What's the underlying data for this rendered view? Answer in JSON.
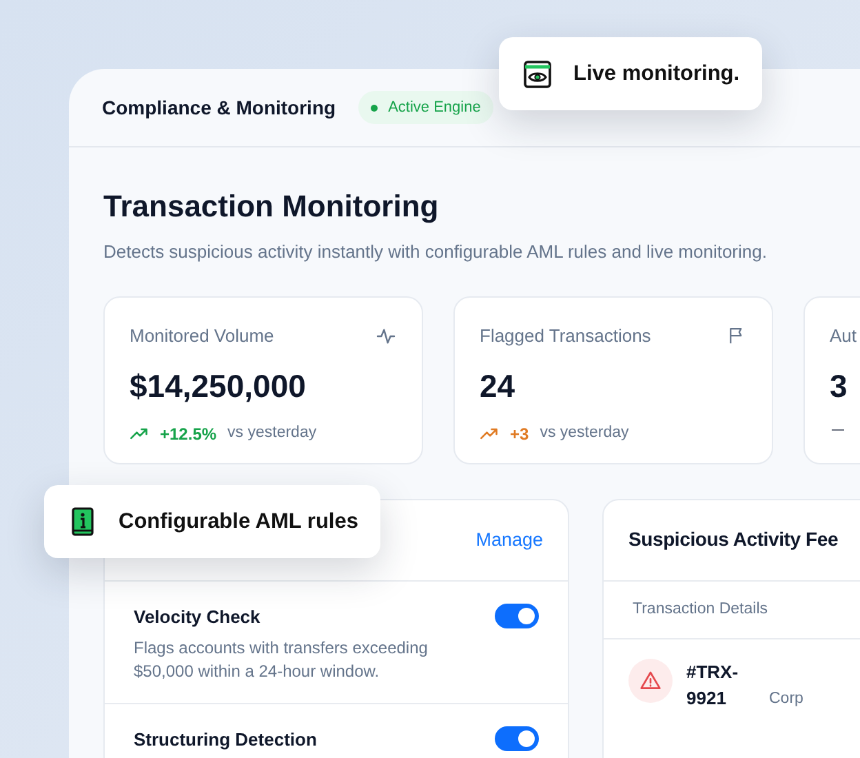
{
  "header": {
    "title": "Compliance & Monitoring",
    "badge": "Active Engine"
  },
  "page": {
    "title": "Transaction Monitoring",
    "subtitle": "Detects suspicious activity instantly with configurable AML rules and live monitoring."
  },
  "stats": [
    {
      "label": "Monitored Volume",
      "value": "$14,250,000",
      "kind": "up",
      "delta": "+12.5%",
      "color": "#16a34a",
      "note": "vs yesterday"
    },
    {
      "label": "Flagged Transactions",
      "value": "24",
      "kind": "up",
      "delta": "+3",
      "color": "#e07b24",
      "note": "vs yesterday"
    },
    {
      "label": "Aut",
      "value": "3",
      "kind": "flat",
      "color": "#6b7280"
    }
  ],
  "rules": {
    "action": "Manage",
    "items": [
      {
        "name": "Velocity Check",
        "description": "Flags accounts with transfers exceeding $50,000 within a 24-hour window.",
        "on": true
      },
      {
        "name": "Structuring Detection",
        "on": true
      }
    ]
  },
  "feed": {
    "title": "Suspicious Activity Fee",
    "column": "Transaction Details",
    "rows": [
      {
        "id": "#TRX-9921",
        "party": "Corp"
      }
    ]
  },
  "callouts": [
    {
      "text": "Live monitoring."
    },
    {
      "text": "Configurable AML rules"
    }
  ]
}
